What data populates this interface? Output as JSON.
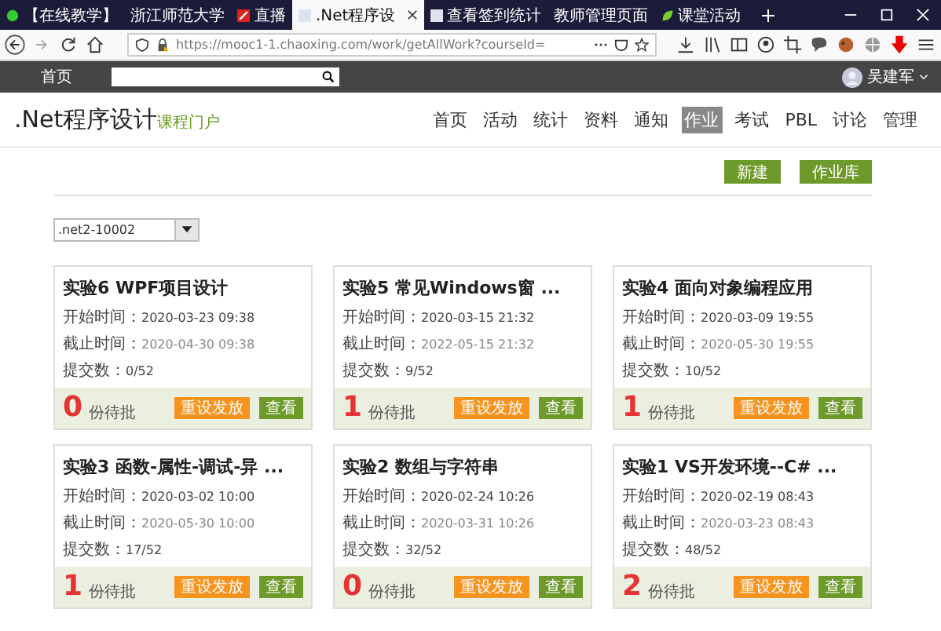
{
  "browser": {
    "tabs": [
      {
        "title": "【在线教学】",
        "selected": false
      },
      {
        "title": "浙江师范大学",
        "selected": false
      },
      {
        "title": "直播",
        "selected": false
      },
      {
        "title": ".Net程序设",
        "selected": true
      },
      {
        "title": "查看签到统计",
        "selected": false
      },
      {
        "title": "教师管理页面",
        "selected": false
      },
      {
        "title": "课堂活动",
        "selected": false
      }
    ],
    "url": "https://mooc1-1.chaoxing.com/work/getAllWork?courseId="
  },
  "site_header": {
    "home": "首页",
    "user": "吴建军"
  },
  "course": {
    "title": ".Net程序设计",
    "subtitle": "课程门户",
    "nav": [
      {
        "label": "首页",
        "selected": false
      },
      {
        "label": "活动",
        "selected": false
      },
      {
        "label": "统计",
        "selected": false
      },
      {
        "label": "资料",
        "selected": false
      },
      {
        "label": "通知",
        "selected": false
      },
      {
        "label": "作业",
        "selected": true
      },
      {
        "label": "考试",
        "selected": false
      },
      {
        "label": "PBL",
        "selected": false
      },
      {
        "label": "讨论",
        "selected": false
      },
      {
        "label": "管理",
        "selected": false
      }
    ]
  },
  "actions": [
    "新建",
    "作业库"
  ],
  "class_select": {
    "value": ".net2-10002"
  },
  "assignments": [
    {
      "title": "实验6 WPF项目设计",
      "start_label": "开始时间：",
      "start": "2020-03-23 09:38",
      "end_label": "截止时间：",
      "end": "2020-04-30 09:38",
      "submit_label": "提交数：",
      "submitted": "0/52",
      "pending": "0",
      "pending_label": "份待批",
      "reset": "重设发放",
      "view": "查看"
    },
    {
      "title": "实验5 常见Windows窗 ...",
      "start_label": "开始时间：",
      "start": "2020-03-15 21:32",
      "end_label": "截止时间：",
      "end": "2022-05-15 21:32",
      "submit_label": "提交数：",
      "submitted": "9/52",
      "pending": "1",
      "pending_label": "份待批",
      "reset": "重设发放",
      "view": "查看"
    },
    {
      "title": "实验4 面向对象编程应用",
      "start_label": "开始时间：",
      "start": "2020-03-09 19:55",
      "end_label": "截止时间：",
      "end": "2020-05-30 19:55",
      "submit_label": "提交数：",
      "submitted": "10/52",
      "pending": "1",
      "pending_label": "份待批",
      "reset": "重设发放",
      "view": "查看"
    },
    {
      "title": "实验3 函数-属性-调试-异 ...",
      "start_label": "开始时间：",
      "start": "2020-03-02 10:00",
      "end_label": "截止时间：",
      "end": "2020-05-30 10:00",
      "submit_label": "提交数：",
      "submitted": "17/52",
      "pending": "1",
      "pending_label": "份待批",
      "reset": "重设发放",
      "view": "查看"
    },
    {
      "title": "实验2 数组与字符串",
      "start_label": "开始时间：",
      "start": "2020-02-24 10:26",
      "end_label": "截止时间：",
      "end": "2020-03-31 10:26",
      "submit_label": "提交数：",
      "submitted": "32/52",
      "pending": "0",
      "pending_label": "份待批",
      "reset": "重设发放",
      "view": "查看"
    },
    {
      "title": "实验1 VS开发环境--C# ...",
      "start_label": "开始时间：",
      "start": "2020-02-19 08:43",
      "end_label": "截止时间：",
      "end": "2020-03-23 08:43",
      "submit_label": "提交数：",
      "submitted": "48/52",
      "pending": "2",
      "pending_label": "份待批",
      "reset": "重设发放",
      "view": "查看"
    }
  ]
}
